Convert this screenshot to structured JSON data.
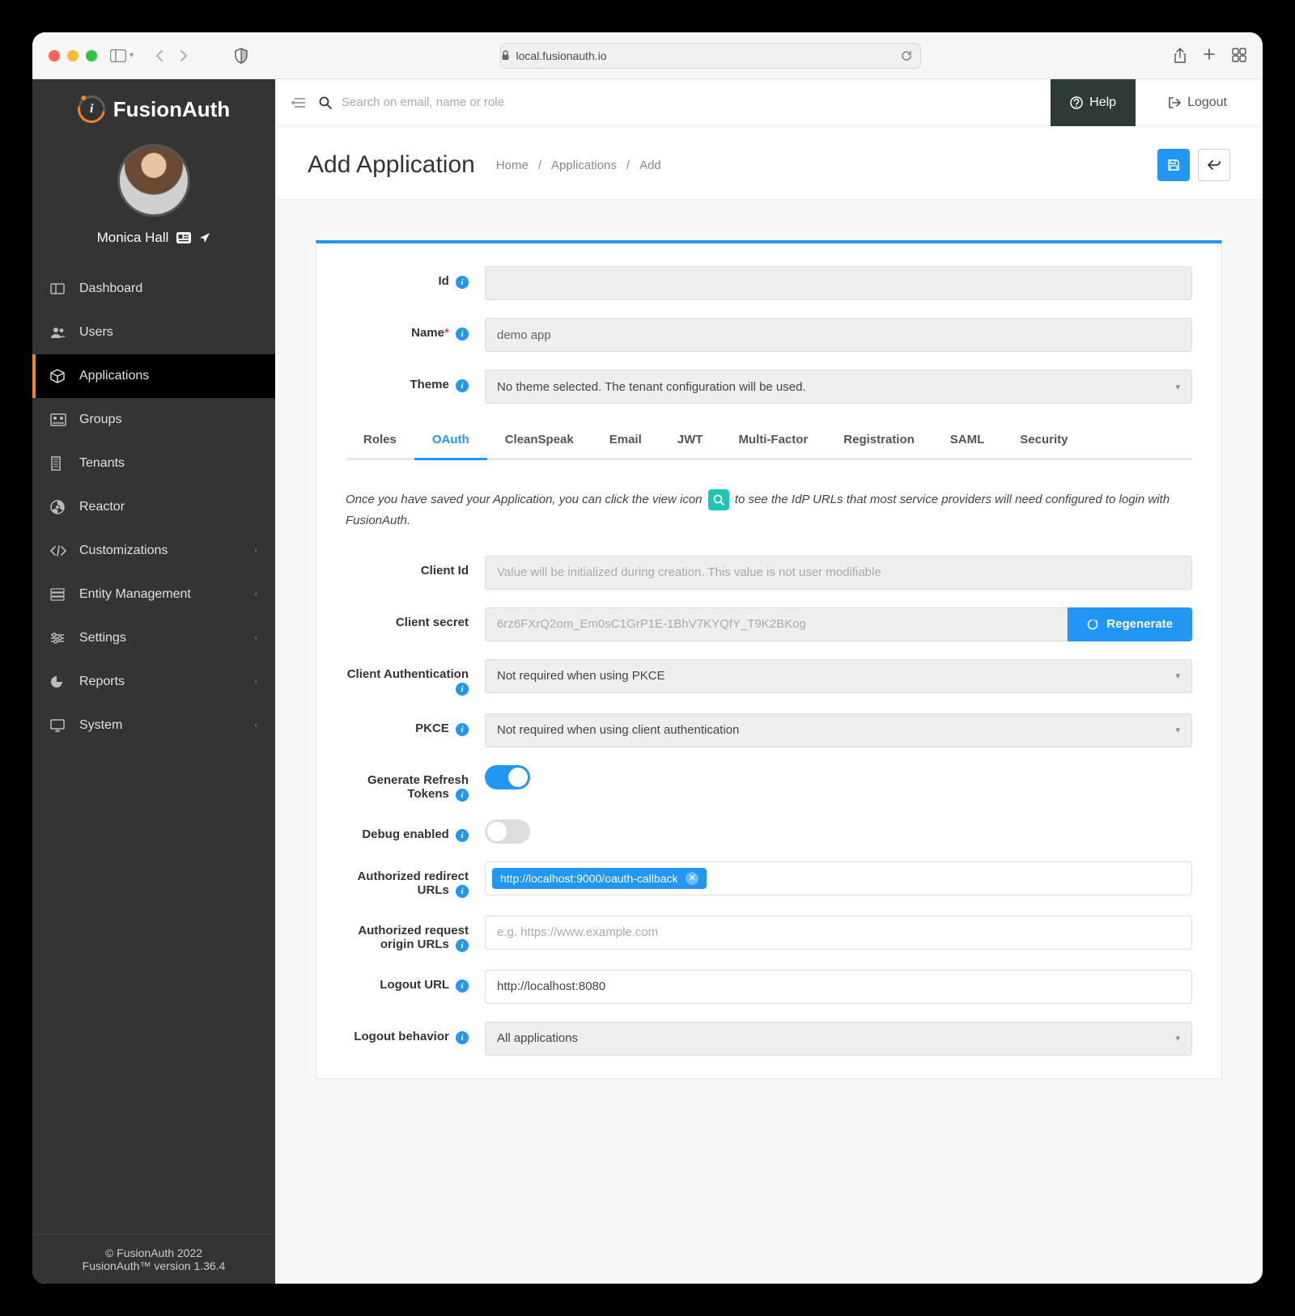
{
  "browser": {
    "url_host": "local.fusionauth.io"
  },
  "brand": "FusionAuth",
  "user": {
    "name": "Monica Hall"
  },
  "sidebar": {
    "items": [
      {
        "label": "Dashboard"
      },
      {
        "label": "Users"
      },
      {
        "label": "Applications"
      },
      {
        "label": "Groups"
      },
      {
        "label": "Tenants"
      },
      {
        "label": "Reactor"
      },
      {
        "label": "Customizations",
        "expandable": true
      },
      {
        "label": "Entity Management",
        "expandable": true
      },
      {
        "label": "Settings",
        "expandable": true
      },
      {
        "label": "Reports",
        "expandable": true
      },
      {
        "label": "System",
        "expandable": true
      }
    ],
    "footer_line1": "© FusionAuth 2022",
    "footer_line2": "FusionAuth™ version 1.36.4"
  },
  "topbar": {
    "search_placeholder": "Search on email, name or role",
    "help": "Help",
    "logout": "Logout"
  },
  "page": {
    "title": "Add Application",
    "breadcrumb": [
      "Home",
      "Applications",
      "Add"
    ]
  },
  "basic": {
    "id_label": "Id",
    "id_value": "",
    "name_label": "Name",
    "name_value": "demo app",
    "theme_label": "Theme",
    "theme_value": "No theme selected. The tenant configuration will be used."
  },
  "tabs": [
    "Roles",
    "OAuth",
    "CleanSpeak",
    "Email",
    "JWT",
    "Multi-Factor",
    "Registration",
    "SAML",
    "Security"
  ],
  "active_tab": "OAuth",
  "oauth": {
    "hint_pre": "Once you have saved your Application, you can click the view icon",
    "hint_post": "to see the IdP URLs that most service providers will need configured to login with FusionAuth.",
    "client_id_label": "Client Id",
    "client_id_placeholder": "Value will be initialized during creation. This value is not user modifiable",
    "client_secret_label": "Client secret",
    "client_secret_value": "6rz6FXrQ2om_Em0sC1GrP1E-1BhV7KYQfY_T9K2BKog",
    "regenerate": "Regenerate",
    "client_auth_label": "Client Authentication",
    "client_auth_value": "Not required when using PKCE",
    "pkce_label": "PKCE",
    "pkce_value": "Not required when using client authentication",
    "gen_refresh_label": "Generate Refresh Tokens",
    "debug_label": "Debug enabled",
    "redirect_label": "Authorized redirect URLs",
    "redirect_chip": "http://localhost:9000/oauth-callback",
    "origin_label": "Authorized request origin URLs",
    "origin_placeholder": "e.g. https://www.example.com",
    "logout_url_label": "Logout URL",
    "logout_url_value": "http://localhost:8080",
    "logout_behavior_label": "Logout behavior",
    "logout_behavior_value": "All applications"
  }
}
